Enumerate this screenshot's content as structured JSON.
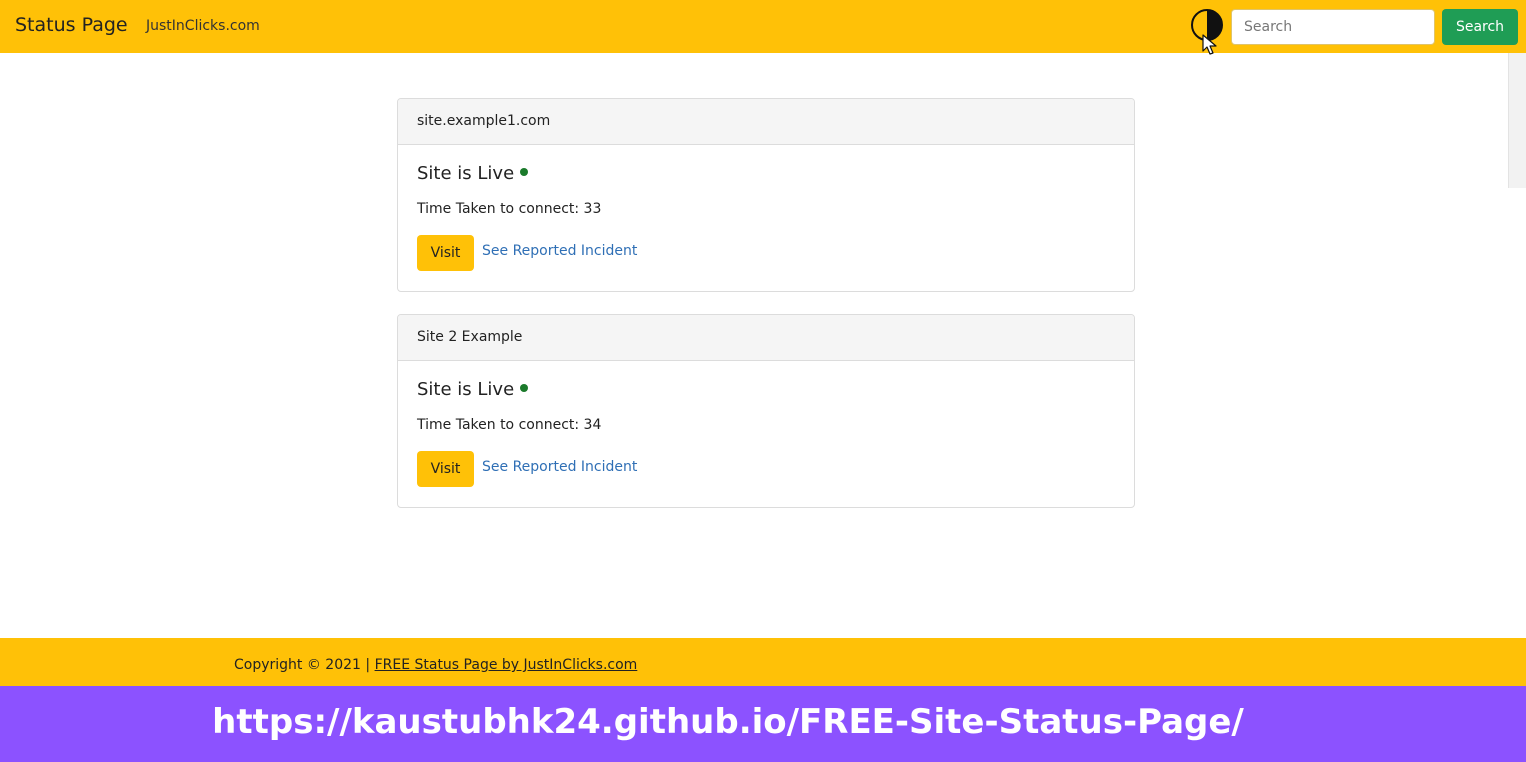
{
  "navbar": {
    "brand": "Status Page",
    "link": "JustInClicks.com",
    "search_placeholder": "Search",
    "search_button": "Search"
  },
  "sites": [
    {
      "name": "site.example1.com",
      "status": "Site is Live",
      "time_taken": "Time Taken to connect: 33",
      "visit_label": "Visit",
      "incident_label": "See Reported Incident"
    },
    {
      "name": "Site 2 Example",
      "status": "Site is Live",
      "time_taken": "Time Taken to connect: 34",
      "visit_label": "Visit",
      "incident_label": "See Reported Incident"
    }
  ],
  "footer": {
    "copyright": "Copyright © 2021 | ",
    "link": "FREE Status Page by JustInClicks.com"
  },
  "banner": {
    "url": "https://kaustubhk24.github.io/FREE-Site-Status-Page/"
  },
  "colors": {
    "accent": "#ffc107",
    "search_button": "#1f9d55",
    "live_dot": "#1b7a2b",
    "link": "#2f6fb5",
    "banner": "#8c52ff"
  },
  "icons": {
    "theme_toggle": "contrast-icon",
    "status_dot": "status-dot-icon"
  }
}
